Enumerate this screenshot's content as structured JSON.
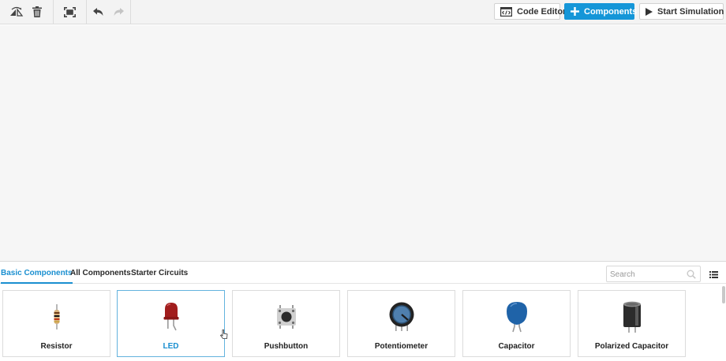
{
  "toolbar": {
    "left_icons": [
      "rotate-icon",
      "delete-icon",
      "fit-view-icon",
      "undo-icon",
      "redo-icon"
    ],
    "code_editor_label": "Code Editor",
    "components_label": "Components",
    "start_simulation_label": "Start Simulation"
  },
  "tabs": [
    {
      "label": "Basic Components",
      "active": true
    },
    {
      "label": "All Components",
      "active": false
    },
    {
      "label": "Starter Circuits",
      "active": false
    }
  ],
  "search": {
    "placeholder": "Search",
    "value": ""
  },
  "components": [
    {
      "label": "Resistor",
      "icon": "resistor-icon",
      "selected": false
    },
    {
      "label": "LED",
      "icon": "led-icon",
      "selected": true
    },
    {
      "label": "Pushbutton",
      "icon": "pushbutton-icon",
      "selected": false
    },
    {
      "label": "Potentiometer",
      "icon": "potentiometer-icon",
      "selected": false
    },
    {
      "label": "Capacitor",
      "icon": "capacitor-icon",
      "selected": false
    },
    {
      "label": "Polarized Capacitor",
      "icon": "polarized-capacitor-icon",
      "selected": false
    }
  ],
  "colors": {
    "accent": "#1596d8",
    "tab_active": "#1a8fd0",
    "led_red": "#a11d1d",
    "capacitor_blue": "#1f63a8"
  }
}
